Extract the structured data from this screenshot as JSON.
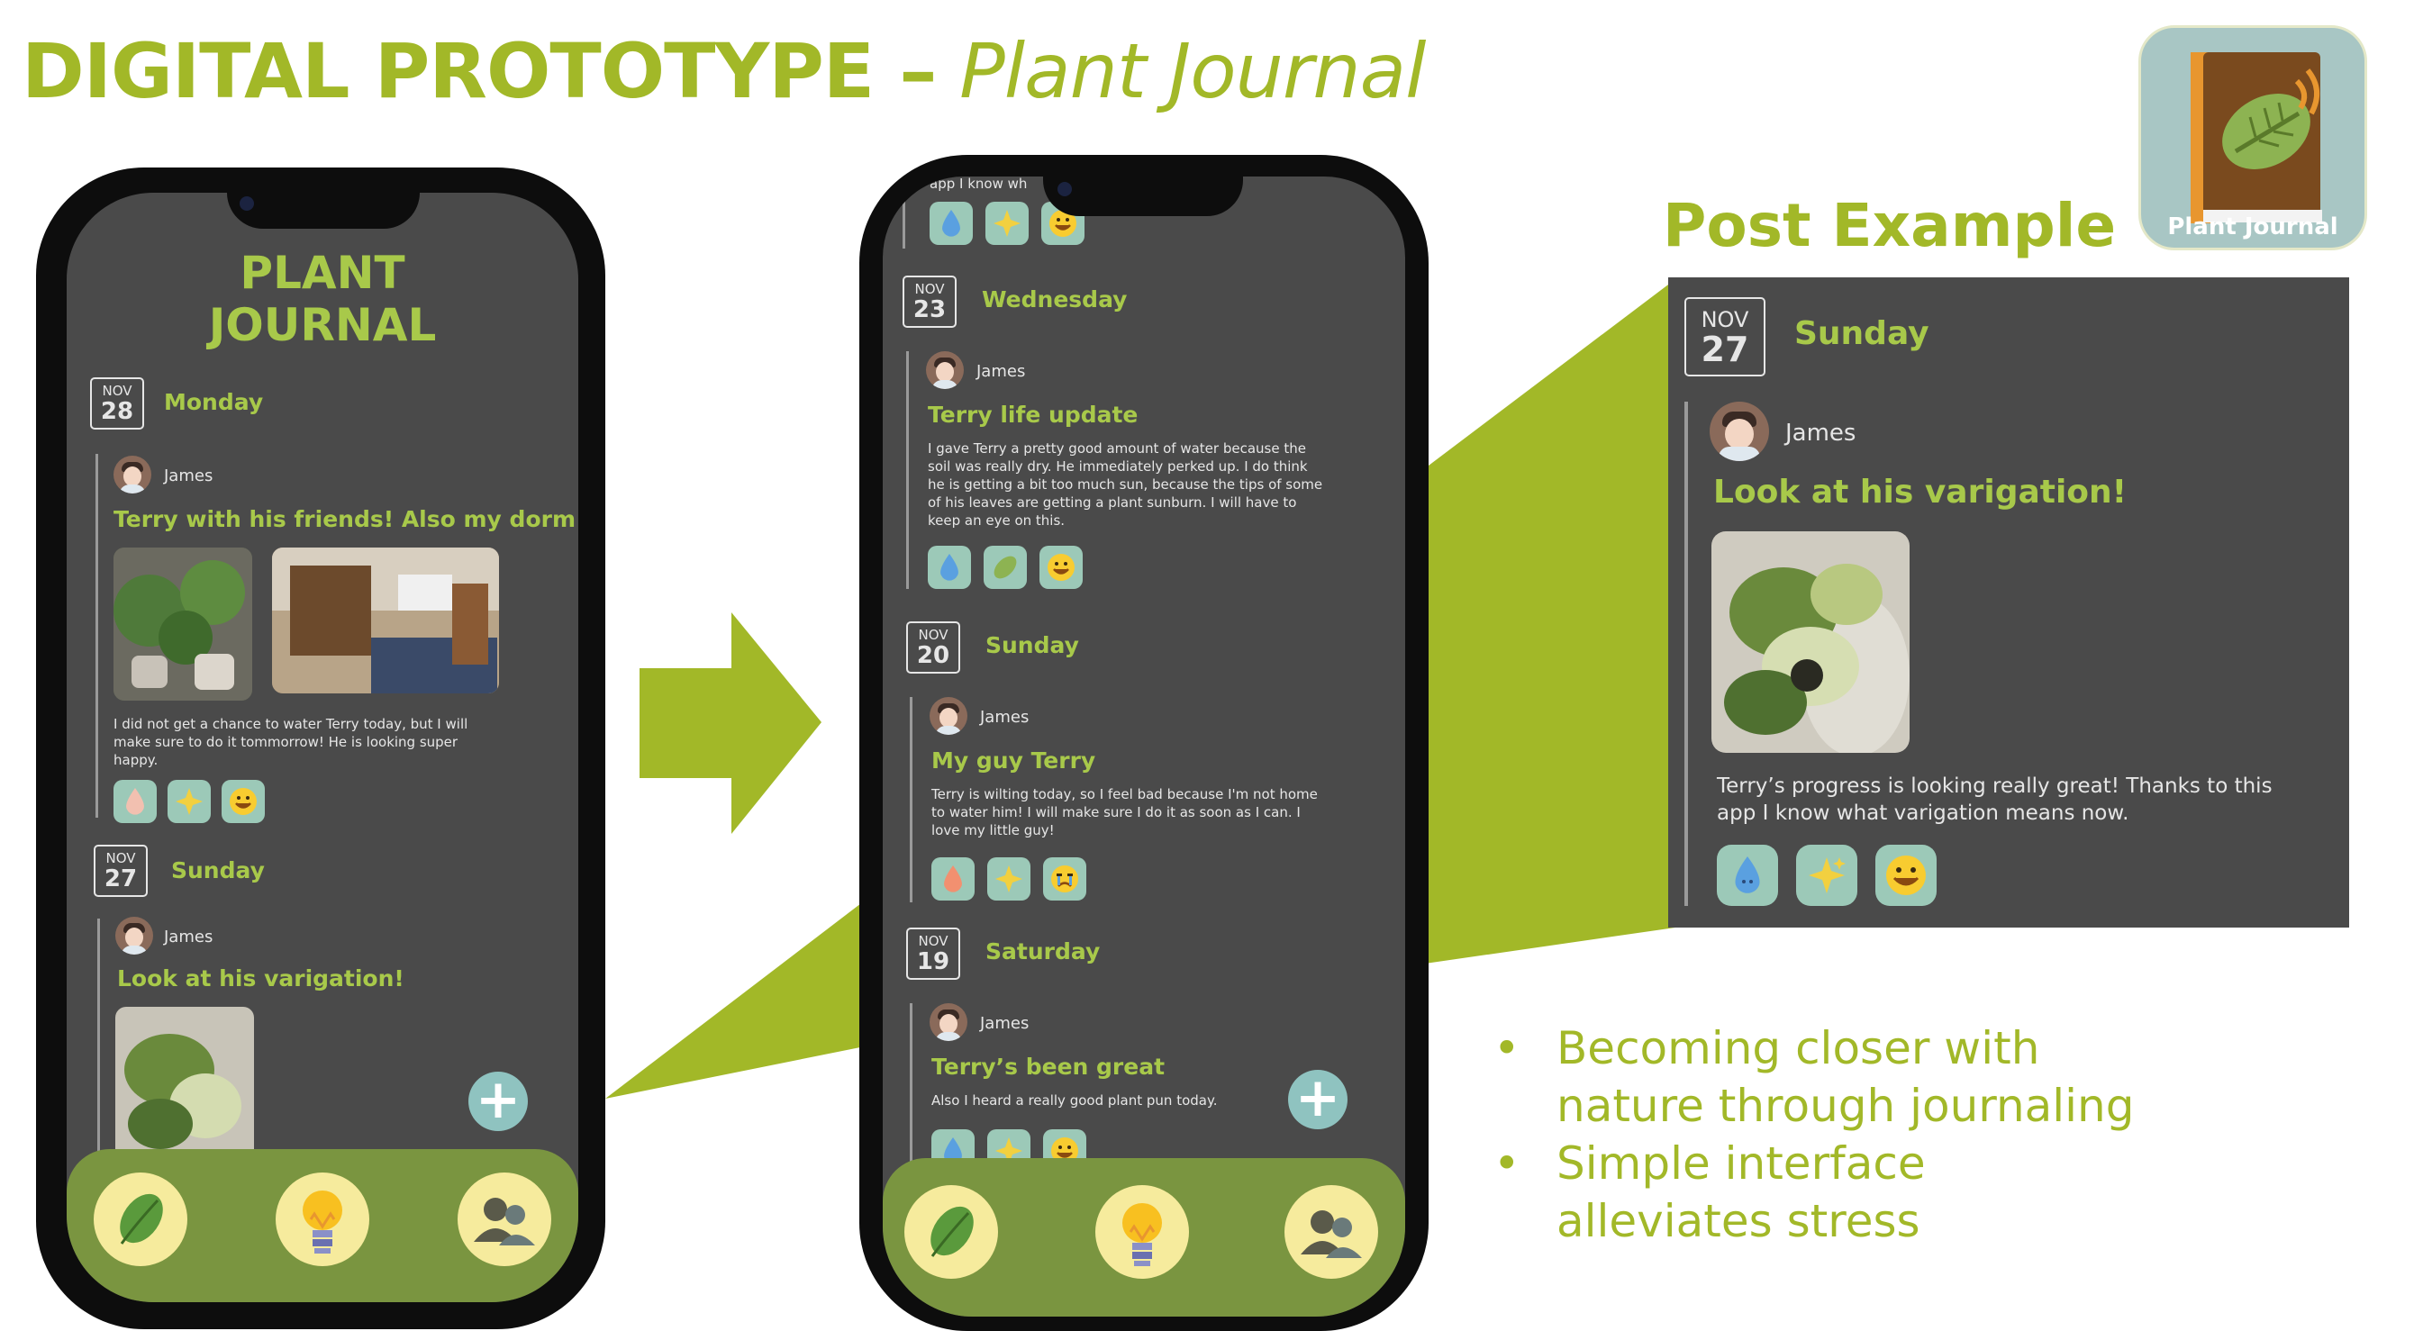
{
  "slide": {
    "title_main": "DIGITAL PROTOTYPE –",
    "title_sub": " Plant Journal",
    "post_example_label": "Post Example",
    "app_icon_label": "Plant Journal",
    "bullets": [
      {
        "line1": "Becoming closer with",
        "line2": "nature through journaling"
      },
      {
        "line1": "Simple interface",
        "line2": "alleviates stress"
      }
    ]
  },
  "phone1": {
    "header": [
      "PLANT",
      "JOURNAL"
    ],
    "entries": [
      {
        "month": "NOV",
        "day": "28",
        "weekday": "Monday",
        "author": "James",
        "title": "Terry with his friends! Also my dorm",
        "text": "I did not get a chance to water Terry today, but I will make sure to do it tommorrow! He is looking super happy."
      },
      {
        "month": "NOV",
        "day": "27",
        "weekday": "Sunday",
        "author": "James",
        "title": "Look at his varigation!"
      }
    ]
  },
  "phone2": {
    "top_text": "app I know wh",
    "entries": [
      {
        "month": "NOV",
        "day": "23",
        "weekday": "Wednesday",
        "author": "James",
        "title": "Terry life update",
        "text": "I gave Terry a pretty good amount of water because the soil was really dry. He immediately perked up. I do think he is getting a bit too much sun, because the tips of some of his leaves are getting a plant sunburn. I will have to keep an eye on this."
      },
      {
        "month": "NOV",
        "day": "20",
        "weekday": "Sunday",
        "author": "James",
        "title": "My guy Terry",
        "text": "Terry is wilting today, so I feel bad because I'm not home to water him! I will make sure I do it as soon as I can. I love my little guy!"
      },
      {
        "month": "NOV",
        "day": "19",
        "weekday": "Saturday",
        "author": "James",
        "title": "Terry’s been great",
        "text": "Also I heard a really good plant pun today."
      }
    ]
  },
  "post_example": {
    "month": "NOV",
    "day": "27",
    "weekday": "Sunday",
    "author": "James",
    "title": "Look at his varigation!",
    "text": "Terry’s progress is looking really great! Thanks to this app I know what varigation means now."
  },
  "nav": {
    "items": [
      "leaf-icon",
      "lightbulb-icon",
      "people-icon"
    ]
  },
  "colors": {
    "accent": "#a2b828",
    "phone_screen": "#4a4a4a",
    "nav_bar": "#7a9540",
    "nav_button": "#f6eb9d",
    "reaction": "#9cc9b8"
  }
}
